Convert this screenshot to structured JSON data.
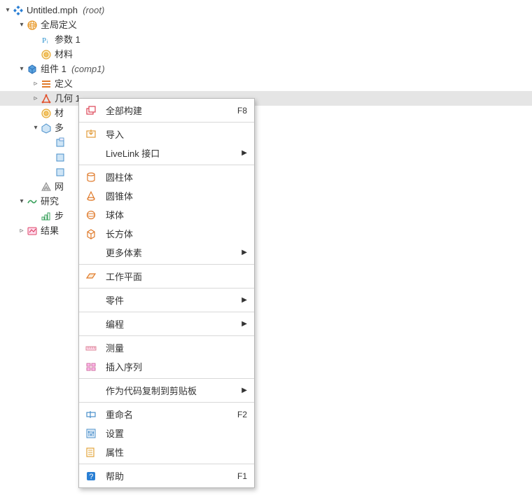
{
  "tree": {
    "root_label": "Untitled.mph",
    "root_suffix": "(root)",
    "global_defs": "全局定义",
    "params1": "参数 1",
    "materials": "材料",
    "comp1_label": "组件 1",
    "comp1_suffix": "(comp1)",
    "definitions": "定义",
    "geometry1": "几何 1",
    "materials2": "材",
    "multi": "多",
    "mesh": "网",
    "study": "研究",
    "step": "步",
    "results": "结果"
  },
  "menu": {
    "build_all": "全部构建",
    "build_all_key": "F8",
    "import": "导入",
    "livelink": "LiveLink 接口",
    "cylinder": "圆柱体",
    "cone": "圆锥体",
    "sphere": "球体",
    "block": "长方体",
    "more_primitives": "更多体素",
    "workplane": "工作平面",
    "parts": "零件",
    "programming": "编程",
    "measure": "测量",
    "insert_sequence": "插入序列",
    "copy_clipboard": "作为代码复制到剪贴板",
    "rename": "重命名",
    "rename_key": "F2",
    "settings": "设置",
    "properties": "属性",
    "help": "帮助",
    "help_key": "F1"
  }
}
